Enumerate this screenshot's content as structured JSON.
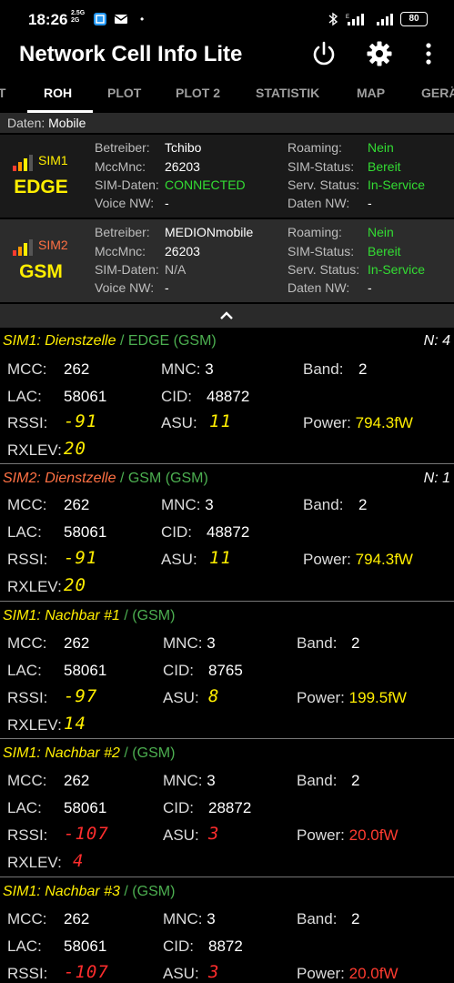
{
  "status_bar": {
    "time": "18:26",
    "net_top": "2.5G",
    "net_bottom": "2G",
    "battery": "80"
  },
  "app": {
    "title": "Network Cell Info Lite",
    "icons": [
      "power-icon",
      "gear-icon",
      "more-vert-icon"
    ]
  },
  "tabs": [
    "IT",
    "ROH",
    "PLOT",
    "PLOT 2",
    "STATISTIK",
    "MAP",
    "GERÄ"
  ],
  "daten": {
    "label": "Daten:",
    "value": "Mobile"
  },
  "sims": [
    {
      "name": "SIM1",
      "tech": "EDGE",
      "betreiber_k": "Betreiber:",
      "betreiber": "Tchibo",
      "mccmnc_k": "MccMnc:",
      "mccmnc": "26203",
      "simdaten_k": "SIM-Daten:",
      "simdaten": "CONNECTED",
      "voice_k": "Voice NW:",
      "voice": "-",
      "roaming_k": "Roaming:",
      "roaming": "Nein",
      "simstatus_k": "SIM-Status:",
      "simstatus": "Bereit",
      "serv_k": "Serv. Status:",
      "serv": "In-Service",
      "datennw_k": "Daten NW:",
      "datennw": "-"
    },
    {
      "name": "SIM2",
      "tech": "GSM",
      "betreiber_k": "Betreiber:",
      "betreiber": "MEDIONmobile",
      "mccmnc_k": "MccMnc:",
      "mccmnc": "26203",
      "simdaten_k": "SIM-Daten:",
      "simdaten": "N/A",
      "voice_k": "Voice NW:",
      "voice": "-",
      "roaming_k": "Roaming:",
      "roaming": "Nein",
      "simstatus_k": "SIM-Status:",
      "simstatus": "Bereit",
      "serv_k": "Serv. Status:",
      "serv": "In-Service",
      "datennw_k": "Daten NW:",
      "datennw": "-"
    }
  ],
  "cells": [
    {
      "title": "SIM1: Dienstzelle",
      "sub": " / EDGE (GSM)",
      "n": "N: 4",
      "mcc": "262",
      "mnc": "3",
      "band": "2",
      "lac": "58061",
      "cid": "48872",
      "rssi": "-91",
      "asu": "11",
      "power": "794.3fW",
      "rxlev": "20"
    },
    {
      "title": "SIM2: Dienstzelle",
      "sub": " / GSM (GSM)",
      "n": "N: 1",
      "mcc": "262",
      "mnc": "3",
      "band": "2",
      "lac": "58061",
      "cid": "48872",
      "rssi": "-91",
      "asu": "11",
      "power": "794.3fW",
      "rxlev": "20"
    },
    {
      "title": "SIM1: Nachbar #1",
      "sub": " / (GSM)",
      "n": "",
      "mcc": "262",
      "mnc": "3",
      "band": "2",
      "lac": "58061",
      "cid": "8765",
      "rssi": "-97",
      "asu": "8",
      "power": "199.5fW",
      "rxlev": "14"
    },
    {
      "title": "SIM1: Nachbar #2",
      "sub": " / (GSM)",
      "n": "",
      "mcc": "262",
      "mnc": "3",
      "band": "2",
      "lac": "58061",
      "cid": "28872",
      "rssi": "-107",
      "asu": "3",
      "power": "20.0fW",
      "rxlev": "4"
    },
    {
      "title": "SIM1: Nachbar #3",
      "sub": " / (GSM)",
      "n": "",
      "mcc": "262",
      "mnc": "3",
      "band": "2",
      "lac": "58061",
      "cid": "8872",
      "rssi": "-107",
      "asu": "3",
      "power": "20.0fW",
      "rxlev": ""
    }
  ],
  "labels": {
    "mcc": "MCC:",
    "mnc": "MNC:",
    "band": "Band:",
    "lac": "LAC:",
    "cid": "CID:",
    "rssi": "RSSI:",
    "asu": "ASU:",
    "power": "Power:",
    "rxlev": "RXLEV:"
  },
  "colors": {
    "signal_yellow": "#ffee00",
    "signal_red": "#ff2d2d",
    "ok_green": "#33dd33",
    "sim2_title": "#ff7043",
    "tech_green": "#4caf50"
  }
}
